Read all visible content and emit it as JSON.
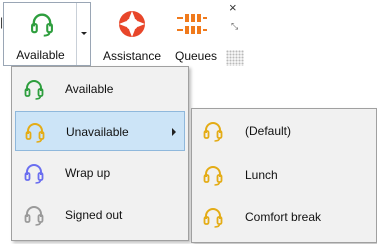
{
  "toolbar": {
    "available": {
      "label": "Available",
      "icon": "headset-icon",
      "color": "#2e9e3e"
    },
    "assistance": {
      "label": "Assistance",
      "icon": "lifebuoy-icon",
      "color": "#e8462a"
    },
    "queues": {
      "label": "Queues",
      "icon": "queues-icon",
      "color": "#f07a1c"
    },
    "close_glyph": "×",
    "expand_glyph": "⤡"
  },
  "status_menu": {
    "items": [
      {
        "label": "Available",
        "icon": "headset-available-icon",
        "color": "#2e9e3e"
      },
      {
        "label": "Unavailable",
        "icon": "headset-unavailable-icon",
        "color": "#e4ac16",
        "selected": true,
        "has_submenu": true
      },
      {
        "label": "Wrap up",
        "icon": "headset-wrapup-icon",
        "color": "#6a6ef0"
      },
      {
        "label": "Signed out",
        "icon": "headset-signedout-icon",
        "color": "#9a9a9a"
      }
    ]
  },
  "unavailable_submenu": {
    "items": [
      {
        "label": "(Default)",
        "icon": "headset-unavailable-icon",
        "color": "#e4ac16"
      },
      {
        "label": "Lunch",
        "icon": "headset-unavailable-icon",
        "color": "#e4ac16"
      },
      {
        "label": "Comfort break",
        "icon": "headset-unavailable-icon",
        "color": "#e4ac16"
      }
    ]
  }
}
